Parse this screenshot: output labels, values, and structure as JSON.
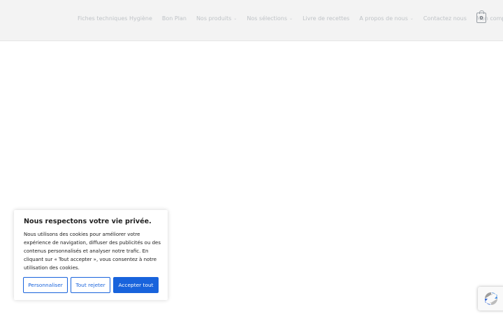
{
  "header": {
    "nav": [
      {
        "label": "Fiches techniques Hygiène",
        "has_dropdown": false
      },
      {
        "label": "Bon Plan",
        "has_dropdown": false
      },
      {
        "label": "Nos produits",
        "has_dropdown": true
      },
      {
        "label": "Nos sélections",
        "has_dropdown": true
      },
      {
        "label": "Livre de recettes",
        "has_dropdown": false
      },
      {
        "label": "A propos de nous",
        "has_dropdown": true
      },
      {
        "label": "Contactez nous",
        "has_dropdown": false
      },
      {
        "label": "Mon compte",
        "has_dropdown": false
      }
    ],
    "cart_count": "0"
  },
  "consent": {
    "title": "Nous respectons votre vie privée.",
    "body": "Nous utilisons des cookies pour améliorer votre expérience de navigation, diffuser des publicités ou des contenus personnalisés et analyser notre trafic. En cliquant sur « Tout accepter », vous consentez à notre utilisation des cookies.",
    "customize_label": "Personnaliser",
    "reject_label": "Tout rejeter",
    "accept_label": "Accepter tout"
  },
  "colors": {
    "accent": "#1863dc",
    "nav_text": "#bfc3c7",
    "header_bg": "#f3f3f3"
  },
  "icons": {
    "cart": "cart-icon",
    "chevron": "chevron-down-icon",
    "recaptcha": "recaptcha-icon"
  }
}
